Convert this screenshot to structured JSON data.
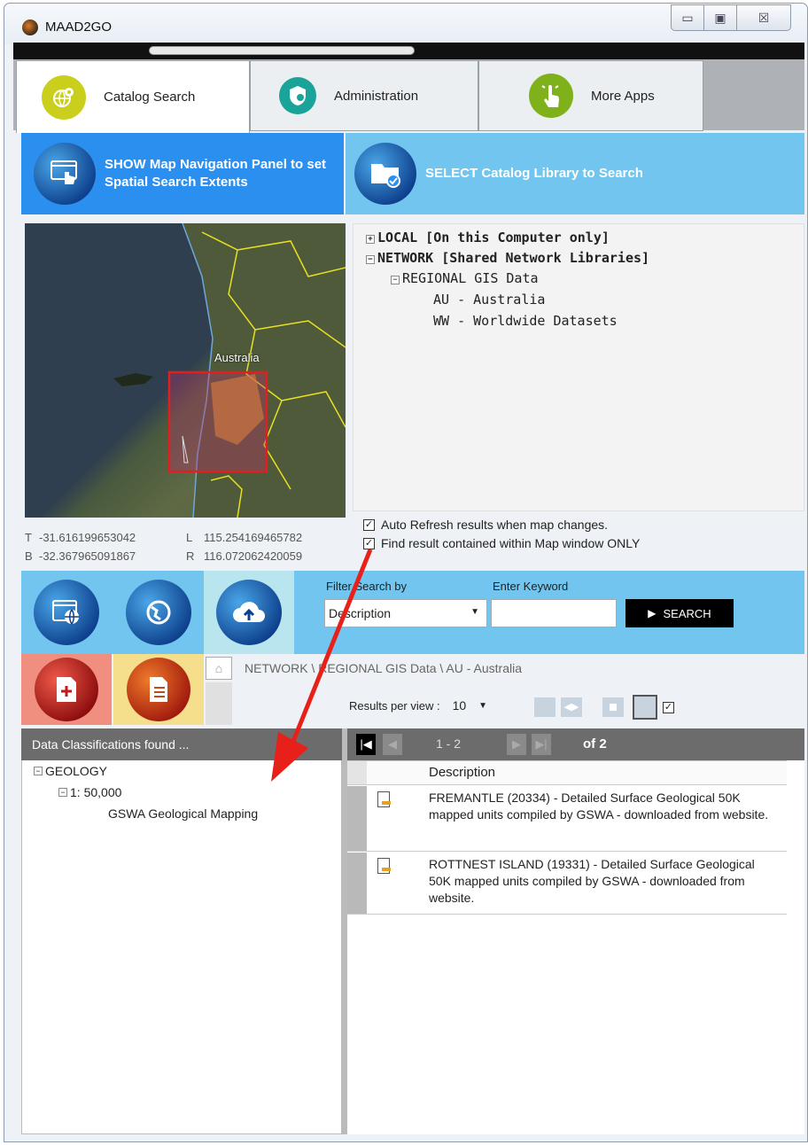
{
  "window": {
    "title": "MAAD2GO",
    "controls": {
      "minimize": "▭",
      "maximize": "▣",
      "close": "☒"
    }
  },
  "tabs": [
    {
      "label": "Catalog Search",
      "icon": "globe-pin-icon",
      "color": "#c9cf1c"
    },
    {
      "label": "Administration",
      "icon": "shield-icon",
      "color": "#1aa398"
    },
    {
      "label": "More Apps",
      "icon": "touch-icon",
      "color": "#7fb21a"
    }
  ],
  "actions": {
    "map_nav_label": "SHOW Map Navigation Panel to set Spatial Search Extents",
    "catalog_library_label": "SELECT Catalog Library to Search"
  },
  "map": {
    "label": "Australia"
  },
  "coords": {
    "t_label": "T",
    "t_value": "-31.616199653042",
    "l_label": "L",
    "l_value": "115.254169465782",
    "b_label": "B",
    "b_value": "-32.367965091867",
    "r_label": "R",
    "r_value": "116.072062420059"
  },
  "library_tree": {
    "local": "LOCAL  [On this Computer only]",
    "network": "NETWORK  [Shared Network Libraries]",
    "regional": "REGIONAL GIS Data",
    "au": "AU - Australia",
    "ww": "WW - Worldwide Datasets"
  },
  "options": {
    "auto_refresh": "Auto Refresh results when map changes.",
    "contained": "Find result contained within Map window ONLY"
  },
  "filter": {
    "filter_label": "Filter Search by",
    "keyword_label": "Enter Keyword",
    "selected": "Description",
    "search_label": "SEARCH"
  },
  "breadcrumb": "NETWORK \\ REGIONAL GIS Data \\ AU - Australia",
  "results_per_view": {
    "label": "Results per view :",
    "value": "10"
  },
  "classifications": {
    "header": "Data Classifications found ...",
    "geology": "GEOLOGY",
    "scale": "1:  50,000",
    "mapping": "GSWA Geological Mapping"
  },
  "pager": {
    "range": "1 - 2",
    "of": "of  2"
  },
  "grid": {
    "column": "Description",
    "rows": [
      "FREMANTLE (20334) - Detailed Surface Geological 50K mapped units compiled by GSWA - downloaded from website.",
      "ROTTNEST ISLAND (19331) - Detailed Surface Geological 50K mapped units compiled by GSWA - downloaded from website."
    ]
  }
}
